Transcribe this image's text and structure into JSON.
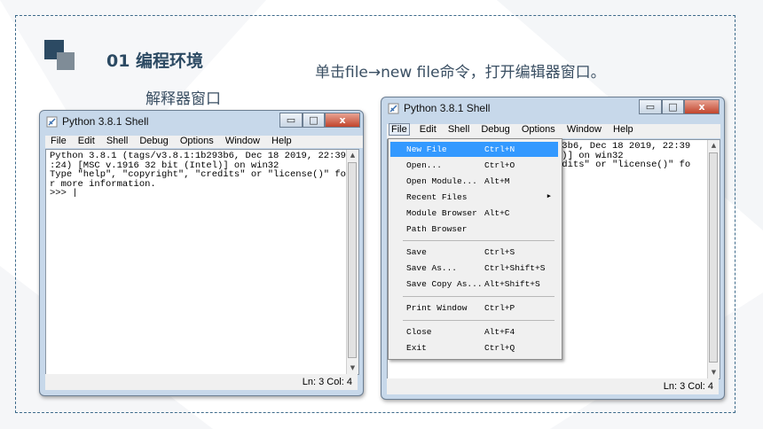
{
  "slide": {
    "heading": "01 编程环境",
    "subtitle": "解释器窗口",
    "instruction": "单击file→new file命令，打开编辑器窗口。"
  },
  "colors": {
    "accent": "#2c4a63",
    "frame": "#3d6a8a",
    "menu_highlight": "#3399ff"
  },
  "shell_left": {
    "title": "Python 3.8.1 Shell",
    "menu": [
      "File",
      "Edit",
      "Shell",
      "Debug",
      "Options",
      "Window",
      "Help"
    ],
    "lines": [
      "Python 3.8.1 (tags/v3.8.1:1b293b6, Dec 18 2019, 22:39",
      ":24) [MSC v.1916 32 bit (Intel)] on win32",
      "Type \"help\", \"copyright\", \"credits\" or \"license()\" fo",
      "r more information.",
      ">>> |"
    ],
    "status": "Ln: 3  Col: 4"
  },
  "shell_right": {
    "title": "Python 3.8.1 Shell",
    "menu": [
      "File",
      "Edit",
      "Shell",
      "Debug",
      "Options",
      "Window",
      "Help"
    ],
    "lines": [
      "93b6, Dec 18 2019, 22:39",
      "1)] on win32",
      "edits\" or \"license()\" fo"
    ],
    "status": "Ln: 3  Col: 4"
  },
  "file_menu": [
    {
      "label": "New File",
      "shortcut": "Ctrl+N",
      "selected": true
    },
    {
      "label": "Open...",
      "shortcut": "Ctrl+O"
    },
    {
      "label": "Open Module...",
      "shortcut": "Alt+M"
    },
    {
      "label": "Recent Files",
      "shortcut": "",
      "submenu": true
    },
    {
      "label": "Module Browser",
      "shortcut": "Alt+C"
    },
    {
      "label": "Path Browser",
      "shortcut": ""
    },
    {
      "label": "Save",
      "shortcut": "Ctrl+S"
    },
    {
      "label": "Save As...",
      "shortcut": "Ctrl+Shift+S"
    },
    {
      "label": "Save Copy As...",
      "shortcut": "Alt+Shift+S"
    },
    {
      "label": "Print Window",
      "shortcut": "Ctrl+P"
    },
    {
      "label": "Close",
      "shortcut": "Alt+F4"
    },
    {
      "label": "Exit",
      "shortcut": "Ctrl+Q"
    }
  ],
  "icons": {
    "window_icon": "python-feather-icon",
    "minimize": "minimize-icon",
    "maximize": "maximize-icon",
    "close": "close-icon",
    "submenu": "chevron-right-icon"
  }
}
